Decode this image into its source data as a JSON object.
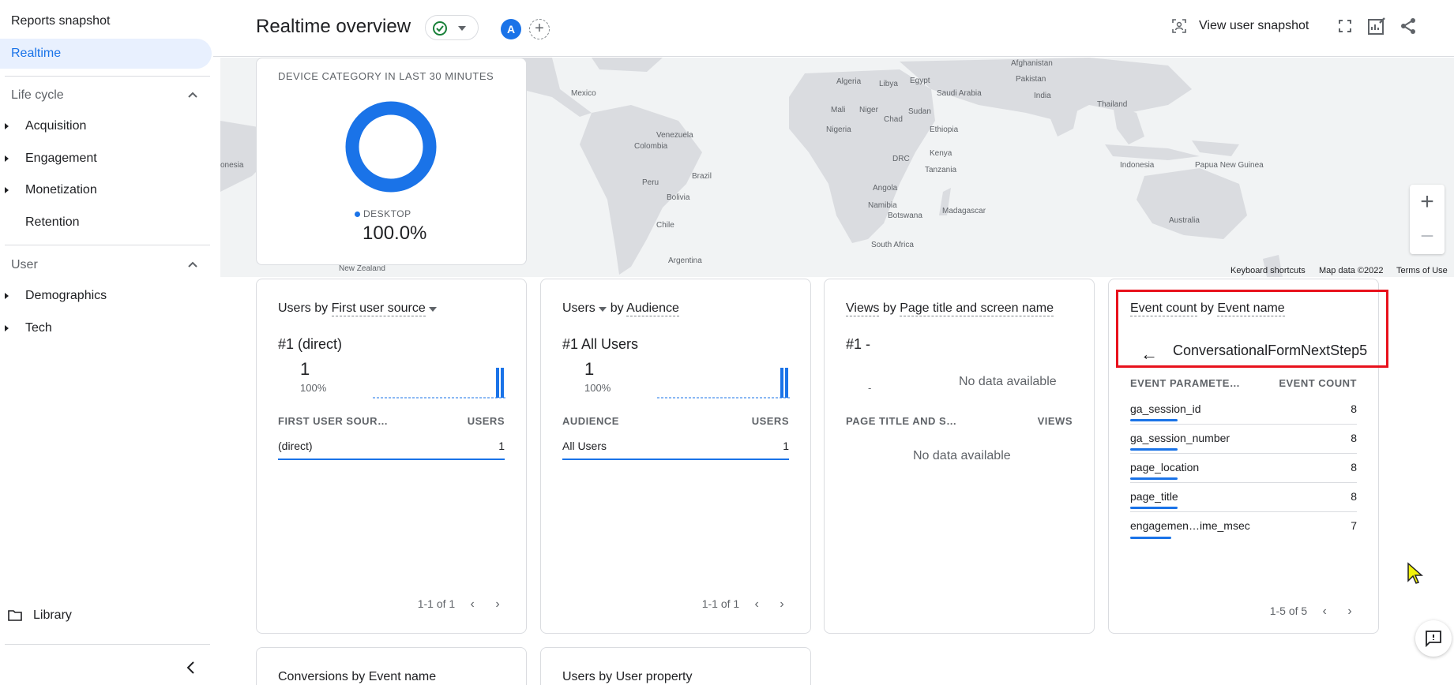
{
  "sidebar": {
    "reports_snapshot": "Reports snapshot",
    "realtime": "Realtime",
    "lifecycle_header": "Life cycle",
    "lifecycle_items": [
      "Acquisition",
      "Engagement",
      "Monetization",
      "Retention"
    ],
    "user_header": "User",
    "user_items": [
      "Demographics",
      "Tech"
    ],
    "library": "Library"
  },
  "header": {
    "title": "Realtime overview",
    "avatar_letter": "A",
    "view_snapshot": "View user snapshot"
  },
  "map": {
    "labels": [
      "Afghanistan",
      "Algeria",
      "Libya",
      "Egypt",
      "Saudi Arabia",
      "Pakistan",
      "India",
      "Mexico",
      "Mali",
      "Niger",
      "Sudan",
      "Chad",
      "Thailand",
      "Venezuela",
      "Colombia",
      "Nigeria",
      "Ethiopia",
      "Kenya",
      "DRC",
      "Tanzania",
      "Indonesia",
      "Papua New Guinea",
      "Peru",
      "Brazil",
      "Bolivia",
      "Angola",
      "Namibia",
      "Botswana",
      "Madagascar",
      "Australia",
      "Chile",
      "South Africa",
      "Argentina",
      "New Zealand",
      "onesia"
    ],
    "footer": [
      "Keyboard shortcuts",
      "Map data ©2022",
      "Terms of Use"
    ],
    "zoom_in": "+",
    "zoom_out": "−"
  },
  "device_card": {
    "heading": "DEVICE CATEGORY IN LAST 30 MINUTES",
    "legend_label": "DESKTOP",
    "legend_value": "100.0%",
    "color": "#1a73e8"
  },
  "source_card": {
    "title_a": "Users by",
    "title_b": "First user source",
    "rank": "#1  (direct)",
    "big": "1",
    "pct": "100%",
    "col1": "FIRST USER SOUR…",
    "col2": "USERS",
    "row_label": "(direct)",
    "row_value": "1",
    "pager": "1-1 of 1"
  },
  "audience_card": {
    "title_a": "Users",
    "title_b": "by",
    "title_c": "Audience",
    "rank": "#1  All Users",
    "big": "1",
    "pct": "100%",
    "col1": "AUDIENCE",
    "col2": "USERS",
    "row_label": "All Users",
    "row_value": "1",
    "pager": "1-1 of 1"
  },
  "views_card": {
    "title_a": "Views",
    "title_b": "by",
    "title_c": "Page title and screen name",
    "rank": "#1  -",
    "dash": "-",
    "nodata_top": "No data available",
    "col1": "PAGE TITLE AND S…",
    "col2": "VIEWS",
    "nodata_bottom": "No data available"
  },
  "event_card": {
    "title_a": "Event count",
    "title_b": "by",
    "title_c": "Event name",
    "event_name": "ConversationalFormNextStep5",
    "col1": "EVENT PARAMETE…",
    "col2": "EVENT COUNT",
    "rows": [
      {
        "label": "ga_session_id",
        "value": "8"
      },
      {
        "label": "ga_session_number",
        "value": "8"
      },
      {
        "label": "page_location",
        "value": "8"
      },
      {
        "label": "page_title",
        "value": "8"
      },
      {
        "label": "engagemen…ime_msec",
        "value": "7"
      }
    ],
    "pager": "1-5 of 5"
  },
  "bottom_cards": {
    "conversions": "Conversions by Event name",
    "user_property": "Users by User property"
  }
}
